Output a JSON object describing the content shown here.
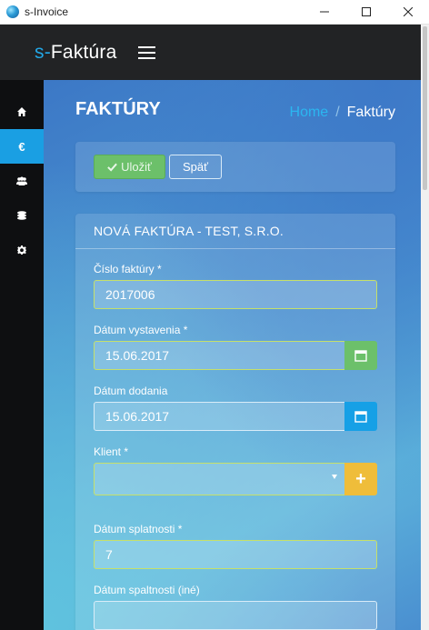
{
  "window": {
    "title": "s-Invoice",
    "icon": "app-globe-icon"
  },
  "header": {
    "brand_prefix": "s-",
    "brand_name": "Faktúra",
    "menu_icon": "hamburger-menu-icon"
  },
  "sidebar": {
    "items": [
      {
        "icon": "home-icon",
        "active": false
      },
      {
        "icon": "euro-icon",
        "glyph": "€",
        "active": true
      },
      {
        "icon": "users-icon",
        "active": false
      },
      {
        "icon": "coins-icon",
        "active": false
      },
      {
        "icon": "gear-icon",
        "active": false
      }
    ]
  },
  "page": {
    "title": "FAKTÚRY",
    "breadcrumb": {
      "home": "Home",
      "separator": "/",
      "current": "Faktúry"
    }
  },
  "toolbar": {
    "save_label": "Uložiť",
    "back_label": "Späť"
  },
  "form": {
    "title": "NOVÁ FAKTÚRA - TEST, S.R.O.",
    "fields": {
      "invoice_number": {
        "label": "Číslo faktúry *",
        "value": "2017006"
      },
      "issue_date": {
        "label": "Dátum vystavenia *",
        "value": "15.06.2017",
        "addon_icon": "calendar-icon"
      },
      "delivery_date": {
        "label": "Dátum dodania",
        "value": "15.06.2017",
        "addon_icon": "calendar-icon"
      },
      "client": {
        "label": "Klient *",
        "value": "",
        "addon_icon": "plus-icon",
        "addon_glyph": "+"
      },
      "due_days": {
        "label": "Dátum splatnosti *",
        "value": "7"
      },
      "due_other": {
        "label": "Dátum spaltnosti (iné)",
        "value": ""
      }
    }
  },
  "colors": {
    "accent": "#1a9fe3",
    "success": "#6cc06a",
    "warning": "#efbd3a",
    "header_bg": "#222325",
    "sidebar_bg": "#0e0f11"
  }
}
